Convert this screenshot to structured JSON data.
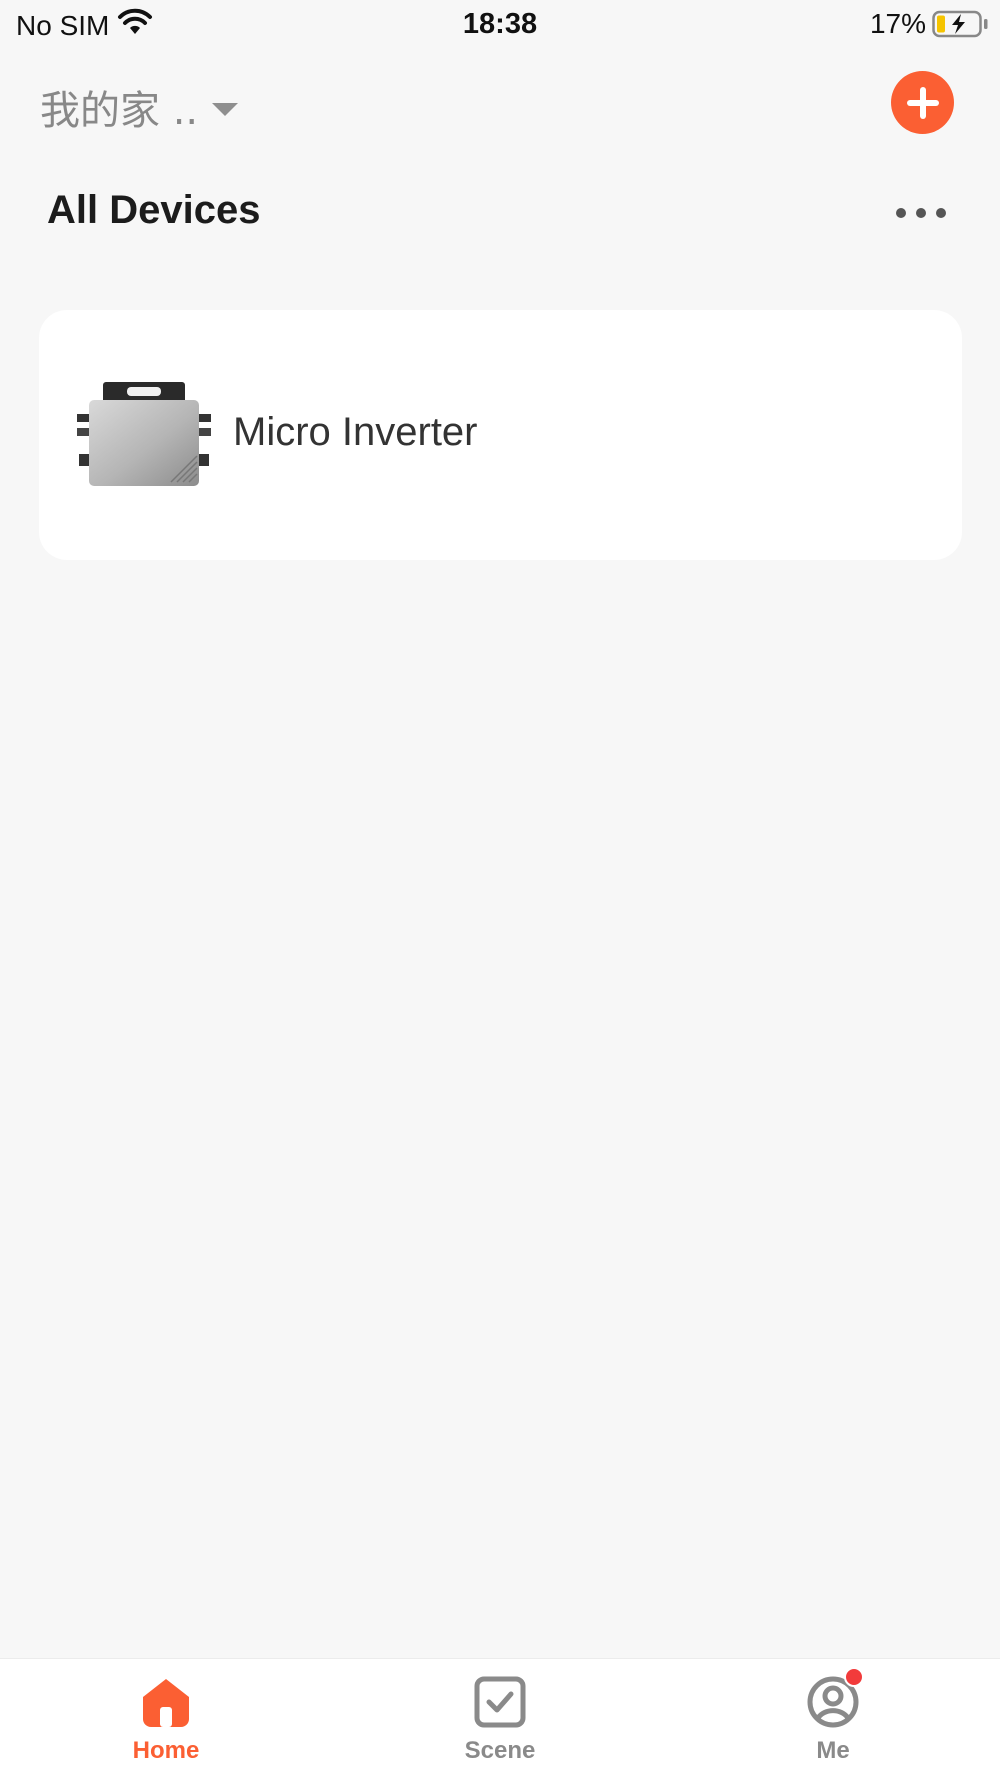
{
  "status_bar": {
    "carrier": "No SIM",
    "time": "18:38",
    "battery": "17%",
    "battery_level": 0.17,
    "charging": true
  },
  "header": {
    "home_name": "我的家 ..",
    "add_icon": "plus-icon"
  },
  "section": {
    "title": "All Devices",
    "more_icon": "more-horizontal-icon"
  },
  "devices": [
    {
      "name": "Micro Inverter",
      "icon": "micro-inverter-image"
    }
  ],
  "tabs": [
    {
      "label": "Home",
      "icon": "home-icon",
      "active": true
    },
    {
      "label": "Scene",
      "icon": "checkbox-icon",
      "active": false
    },
    {
      "label": "Me",
      "icon": "user-icon",
      "active": false,
      "badge": true
    }
  ],
  "colors": {
    "accent": "#fb5f33",
    "background": "#f7f7f7",
    "card": "#ffffff",
    "badge": "#f23b3b",
    "battery_fill": "#f5c400"
  }
}
